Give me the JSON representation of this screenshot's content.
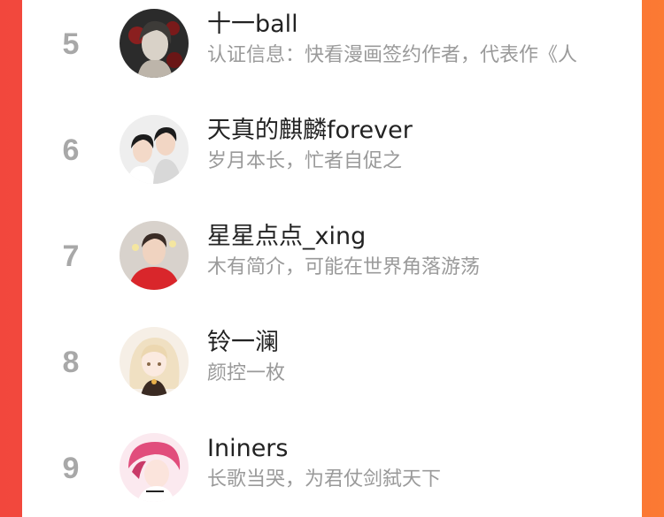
{
  "theme": {
    "accent_left": "#f2473d",
    "accent_right": "#fb7a33",
    "rank_color": "#a8a8a8",
    "name_color": "#222222",
    "desc_color": "#9a9a9a"
  },
  "ranking": {
    "items": [
      {
        "rank": "5",
        "name": "十一ball",
        "description": "认证信息：快看漫画签约作者，代表作《人",
        "avatar_icon": "dark-haired-man-avatar-icon"
      },
      {
        "rank": "6",
        "name": "天真的麒麟forever",
        "description": "岁月本长，忙者自促之",
        "avatar_icon": "two-boys-avatar-icon"
      },
      {
        "rank": "7",
        "name": "星星点点_xing",
        "description": "木有简介，可能在世界角落游荡",
        "avatar_icon": "young-man-red-shirt-avatar-icon"
      },
      {
        "rank": "8",
        "name": "铃一澜",
        "description": "颜控一枚",
        "avatar_icon": "blonde-girl-avatar-icon"
      },
      {
        "rank": "9",
        "name": "Ininers",
        "description": "长歌当哭，为君仗剑弑天下",
        "avatar_icon": "pink-haired-boy-avatar-icon"
      }
    ]
  }
}
